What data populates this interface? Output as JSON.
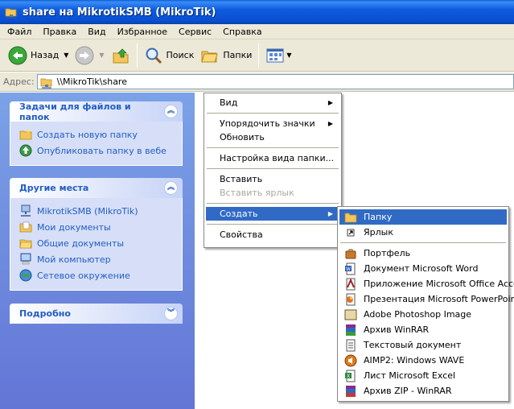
{
  "window": {
    "title": "share на MikrotikSMB (MikroTik)"
  },
  "menubar": [
    "Файл",
    "Правка",
    "Вид",
    "Избранное",
    "Сервис",
    "Справка"
  ],
  "toolbar": {
    "back_label": "Назад",
    "search_label": "Поиск",
    "folders_label": "Папки"
  },
  "address": {
    "label": "Адрес:",
    "value": "\\\\MikroTik\\share"
  },
  "tasks_panel": {
    "title": "Задачи для файлов и папок",
    "items": [
      {
        "label": "Создать новую папку",
        "icon": "new-folder-icon"
      },
      {
        "label": "Опубликовать папку в вебе",
        "icon": "publish-web-icon"
      }
    ]
  },
  "places_panel": {
    "title": "Другие места",
    "items": [
      {
        "label": "MikrotikSMB (MikroTik)",
        "icon": "network-computer-icon"
      },
      {
        "label": "Мои документы",
        "icon": "my-documents-icon"
      },
      {
        "label": "Общие документы",
        "icon": "shared-documents-icon"
      },
      {
        "label": "Мой компьютер",
        "icon": "my-computer-icon"
      },
      {
        "label": "Сетевое окружение",
        "icon": "network-places-icon"
      }
    ]
  },
  "details_panel": {
    "title": "Подробно"
  },
  "context_menu": {
    "view": "Вид",
    "arrange": "Упорядочить значки",
    "refresh": "Обновить",
    "customize": "Настройка вида папки...",
    "paste": "Вставить",
    "paste_shortcut": "Вставить ярлык",
    "new": "Создать",
    "properties": "Свойства"
  },
  "new_submenu": {
    "folder": "Папку",
    "shortcut": "Ярлык",
    "items": [
      {
        "label": "Портфель",
        "icon": "briefcase-icon"
      },
      {
        "label": "Документ Microsoft Word",
        "icon": "word-doc-icon"
      },
      {
        "label": "Приложение Microsoft Office Access",
        "icon": "access-db-icon"
      },
      {
        "label": "Презентация Microsoft PowerPoint",
        "icon": "powerpoint-icon"
      },
      {
        "label": "Adobe Photoshop Image",
        "icon": "photoshop-icon"
      },
      {
        "label": "Архив WinRAR",
        "icon": "winrar-icon"
      },
      {
        "label": "Текстовый документ",
        "icon": "text-doc-icon"
      },
      {
        "label": "AIMP2: Windows WAVE",
        "icon": "wave-audio-icon"
      },
      {
        "label": "Лист Microsoft Excel",
        "icon": "excel-icon"
      },
      {
        "label": "Архив ZIP - WinRAR",
        "icon": "zip-archive-icon"
      }
    ]
  },
  "colors": {
    "selection": "#316ac5",
    "task_link": "#215dc6",
    "title_bar": "#0a4fd0"
  }
}
